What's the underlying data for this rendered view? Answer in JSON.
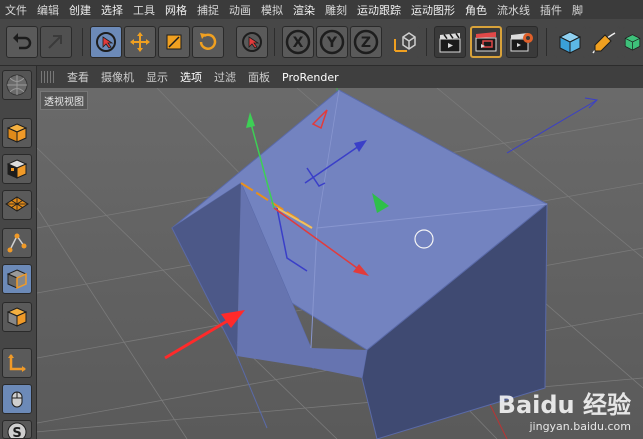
{
  "menu": {
    "items": [
      "文件",
      "编辑",
      "创建",
      "选择",
      "工具",
      "网格",
      "捕捉",
      "动画",
      "模拟",
      "渲染",
      "雕刻",
      "运动跟踪",
      "运动图形",
      "角色",
      "流水线",
      "插件",
      "脚"
    ]
  },
  "toolbar": {
    "undo_icon": "undo-arrow-icon",
    "axis_x": "X",
    "axis_y": "Y",
    "axis_z": "Z"
  },
  "viewport_menu": {
    "items": [
      "查看",
      "摄像机",
      "显示",
      "选项",
      "过滤",
      "面板",
      "ProRender"
    ],
    "active": "选项"
  },
  "viewport": {
    "label": "透视视图"
  },
  "watermark": {
    "logo": "Baidu 经验",
    "url": "jingyan.baidu.com"
  },
  "colors": {
    "cube_face": "#7383c0",
    "cube_dark": "#3f4a72",
    "axis_x": "#e23b3b",
    "axis_y": "#3dcf55",
    "axis_z": "#3e4fd8",
    "selection_blue": "#6c8ab8"
  }
}
